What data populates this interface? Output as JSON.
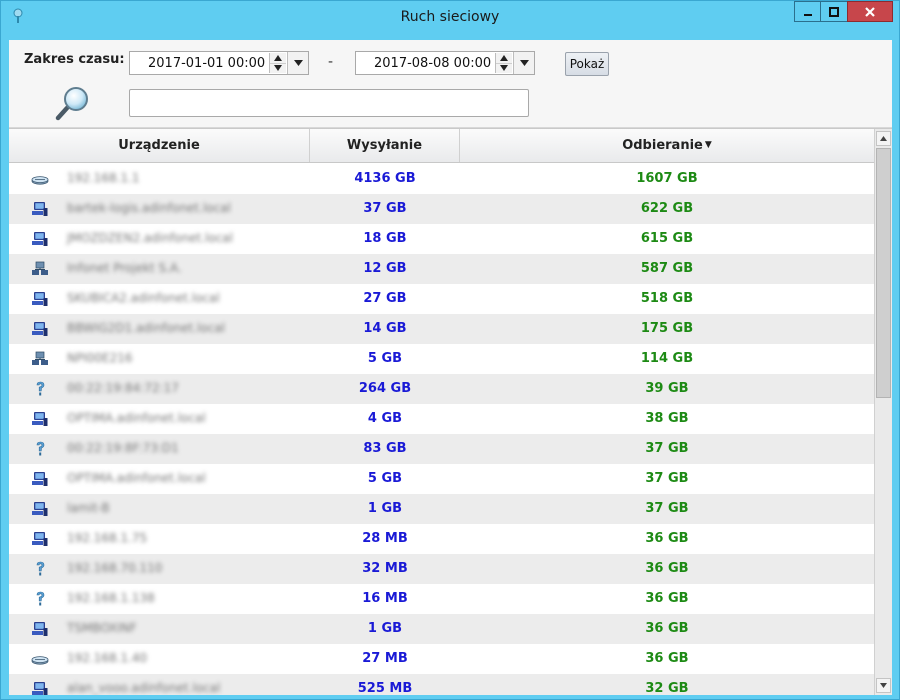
{
  "window": {
    "title": "Ruch sieciowy",
    "accent": "#5fcdf1",
    "close_color": "#c7464b"
  },
  "toolbar": {
    "range_label": "Zakres czasu:",
    "date_from": "2017-01-01 00:00",
    "separator": "-",
    "date_to": "2017-08-08 00:00",
    "show_button": "Pokaż",
    "search_value": "",
    "search_icon": "magnifier-icon"
  },
  "table": {
    "columns": {
      "device": "Urządzenie",
      "send": "Wysyłanie",
      "receive": "Odbieranie",
      "sort_indicator": "▼"
    },
    "rows": [
      {
        "icon": "router-icon",
        "device": "192.168.1.1",
        "send": "4136 GB",
        "recv": "1607 GB"
      },
      {
        "icon": "computer-icon",
        "device": "bartek-logis.adinfonet.local",
        "send": "37 GB",
        "recv": "622 GB"
      },
      {
        "icon": "computer-icon",
        "device": "JMOZDZEN2.adinfonet.local",
        "send": "18 GB",
        "recv": "615 GB"
      },
      {
        "icon": "network-icon",
        "device": "Infonet Projekt S.A.",
        "send": "12 GB",
        "recv": "587 GB"
      },
      {
        "icon": "computer-icon",
        "device": "SKUBICA2.adinfonet.local",
        "send": "27 GB",
        "recv": "518 GB"
      },
      {
        "icon": "computer-icon",
        "device": "BBWIG2D1.adinfonet.local",
        "send": "14 GB",
        "recv": "175 GB"
      },
      {
        "icon": "network-icon",
        "device": "NPI00E216",
        "send": "5 GB",
        "recv": "114 GB"
      },
      {
        "icon": "unknown-icon",
        "device": "00:22:19:84:72:17",
        "send": "264 GB",
        "recv": "39 GB"
      },
      {
        "icon": "computer-icon",
        "device": "OPTIMA.adinfonet.local",
        "send": "4 GB",
        "recv": "38 GB"
      },
      {
        "icon": "unknown-icon",
        "device": "00:22:19:8F:73:D1",
        "send": "83 GB",
        "recv": "37 GB"
      },
      {
        "icon": "computer-icon",
        "device": "OPTIMA.adinfonet.local",
        "send": "5 GB",
        "recv": "37 GB"
      },
      {
        "icon": "computer-icon",
        "device": "lamit-B",
        "send": "1 GB",
        "recv": "37 GB"
      },
      {
        "icon": "computer-icon",
        "device": "192.168.1.75",
        "send": "28 MB",
        "recv": "36 GB"
      },
      {
        "icon": "unknown-icon",
        "device": "192.168.70.110",
        "send": "32 MB",
        "recv": "36 GB"
      },
      {
        "icon": "unknown-icon",
        "device": "192.168.1.138",
        "send": "16 MB",
        "recv": "36 GB"
      },
      {
        "icon": "computer-icon",
        "device": "TSMBOXINF",
        "send": "1 GB",
        "recv": "36 GB"
      },
      {
        "icon": "router-icon",
        "device": "192.168.1.40",
        "send": "27 MB",
        "recv": "36 GB"
      },
      {
        "icon": "computer-icon",
        "device": "alan_vooo.adinfonet.local",
        "send": "525 MB",
        "recv": "32 GB"
      }
    ]
  },
  "colors": {
    "send": "#1a1ad6",
    "receive": "#1d8a14",
    "alt_row": "#ececec"
  }
}
